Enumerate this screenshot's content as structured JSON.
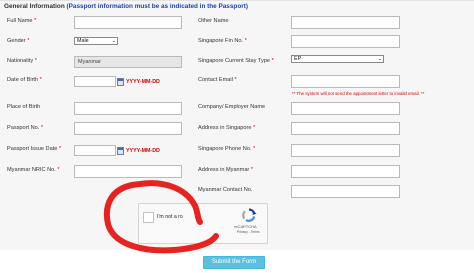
{
  "section": {
    "title": "General Information",
    "subtitle": "(Passport information must be as indicated in the Passport)"
  },
  "left": {
    "full_name": "Full Name",
    "gender": "Gender",
    "gender_value": "Male",
    "nationality": "Nationality",
    "nationality_value": "Myanmar",
    "dob": "Date of Birth",
    "dob_format": "YYYY-MM-DD",
    "place_of_birth": "Place of Birth",
    "passport_no": "Passport No.",
    "passport_issue": "Passport Issue Date",
    "passport_issue_format": "YYYY-MM-DD",
    "nric": "Myanmar NRIC No."
  },
  "right": {
    "other_name": "Other Name",
    "fin": "Singapore Fin No.",
    "stay_type": "Singapore Current Stay Type",
    "stay_type_value": "EP",
    "email": "Contact Email",
    "email_note": "** The system will not send the appointment letter to invalid email. **",
    "employer": "Company/ Employer Name",
    "address_sg": "Address in Singapore",
    "phone_sg": "Singapore Phone No.",
    "address_mm": "Address in Myanmar",
    "contact_mm": "Myanmar Contact No."
  },
  "required_mark": "*",
  "captcha": {
    "label": "I'm not a ro",
    "brand": "reCAPTCHA",
    "terms": "Privacy - Terms"
  },
  "submit_label": "Submit the Form",
  "colors": {
    "required": "#d60000",
    "subtitle": "#1a3fb3",
    "submit": "#5bc0de",
    "annotation": "#e8231f"
  },
  "icons": {
    "calendar": "calendar-icon",
    "recaptcha": "recaptcha-logo-icon",
    "dropdown": "chevron-down-icon"
  }
}
